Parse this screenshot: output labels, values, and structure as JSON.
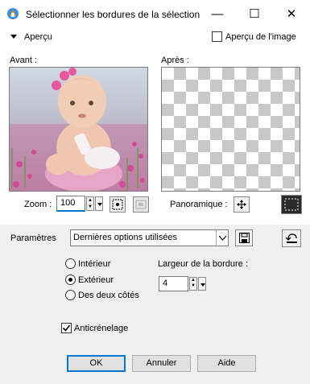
{
  "window": {
    "title": "Sélectionner les bordures de la sélection",
    "minimize_glyph": "—",
    "maximize_glyph": "☐",
    "close_glyph": "✕"
  },
  "preview_header": {
    "section_label": "Aperçu",
    "image_preview_label": "Aperçu de l'image",
    "image_preview_checked": false
  },
  "panels": {
    "before_label": "Avant :",
    "after_label": "Après :"
  },
  "zoom": {
    "label": "Zoom :",
    "value": "100"
  },
  "pan": {
    "label": "Panoramique :"
  },
  "parameters": {
    "label": "Paramètres",
    "preset_value": "Dernières options utilisées"
  },
  "options": {
    "radio_inside": "Intérieur",
    "radio_outside": "Extérieur",
    "radio_both": "Des deux côtés",
    "selected": "Extérieur",
    "border_width_label": "Largeur de la bordure :",
    "border_width_value": "4",
    "antialias_label": "Anticrénelage",
    "antialias_checked": true
  },
  "buttons": {
    "ok": "OK",
    "cancel": "Annuler",
    "help": "Aide"
  },
  "colors": {
    "accent": "#0078d7",
    "dialog_bg": "#f0f0f0"
  }
}
